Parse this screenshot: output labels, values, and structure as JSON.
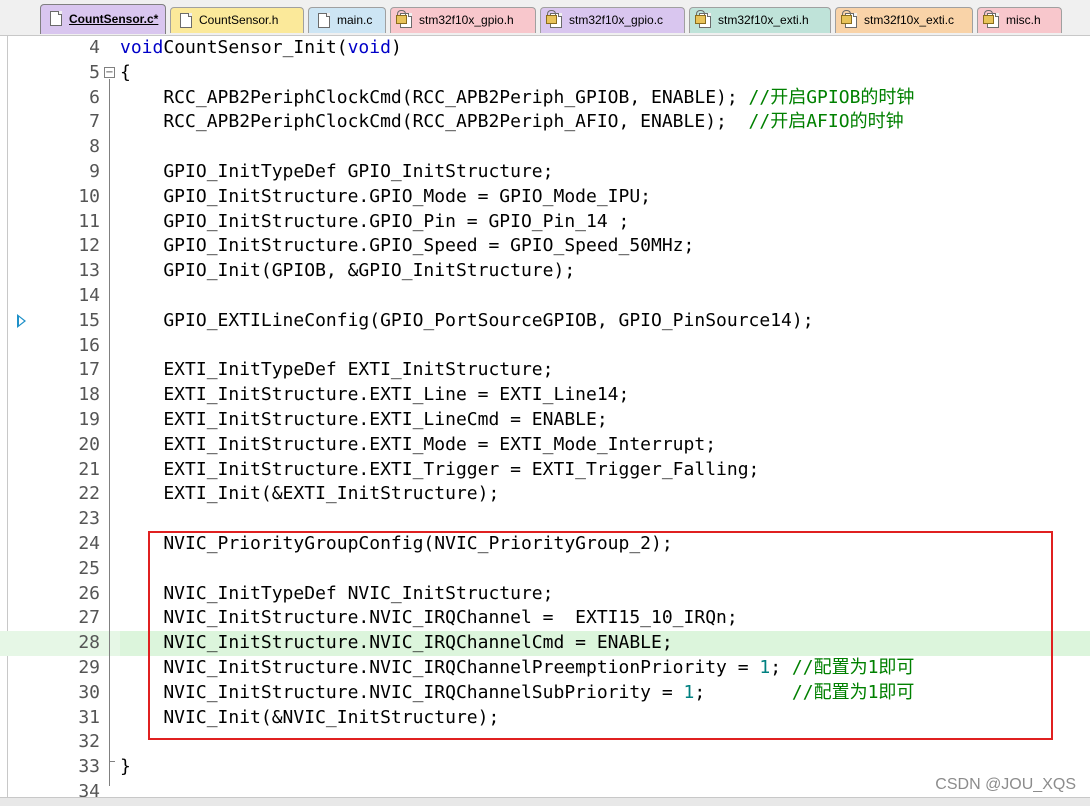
{
  "tabs": [
    {
      "label": "CountSensor.c*",
      "active": true,
      "locked": false,
      "color": "#d9c6ef"
    },
    {
      "label": "CountSensor.h",
      "active": false,
      "locked": false,
      "color": "#fbe99a"
    },
    {
      "label": "main.c",
      "active": false,
      "locked": false,
      "color": "#cde5f4"
    },
    {
      "label": "stm32f10x_gpio.h",
      "active": false,
      "locked": true,
      "color": "#f8c7cc"
    },
    {
      "label": "stm32f10x_gpio.c",
      "active": false,
      "locked": true,
      "color": "#d9c6ef"
    },
    {
      "label": "stm32f10x_exti.h",
      "active": false,
      "locked": true,
      "color": "#bfe3d9"
    },
    {
      "label": "stm32f10x_exti.c",
      "active": false,
      "locked": true,
      "color": "#f9d3a8"
    },
    {
      "label": "misc.h",
      "active": false,
      "locked": true,
      "color": "#f8c7cc"
    }
  ],
  "editor": {
    "current_line": 28,
    "breakpoint_line": 15,
    "lines": [
      {
        "n": "4",
        "code": [
          [
            "kw",
            "void"
          ],
          [
            "",
            "CountSensor_Init("
          ],
          [
            "kw",
            "void"
          ],
          [
            "",
            ")"
          ]
        ]
      },
      {
        "n": "5",
        "code": [
          [
            "",
            "{"
          ]
        ]
      },
      {
        "n": "6",
        "code": [
          [
            "",
            "    RCC_APB2PeriphClockCmd(RCC_APB2Periph_GPIOB, ENABLE); "
          ],
          [
            "cmt",
            "//开启GPIOB的时钟"
          ]
        ]
      },
      {
        "n": "7",
        "code": [
          [
            "",
            "    RCC_APB2PeriphClockCmd(RCC_APB2Periph_AFIO, ENABLE);  "
          ],
          [
            "cmt",
            "//开启AFIO的时钟"
          ]
        ]
      },
      {
        "n": "8",
        "code": []
      },
      {
        "n": "9",
        "code": [
          [
            "",
            "    GPIO_InitTypeDef GPIO_InitStructure;"
          ]
        ]
      },
      {
        "n": "10",
        "code": [
          [
            "",
            "    GPIO_InitStructure.GPIO_Mode = GPIO_Mode_IPU;"
          ]
        ]
      },
      {
        "n": "11",
        "code": [
          [
            "",
            "    GPIO_InitStructure.GPIO_Pin = GPIO_Pin_14 ;"
          ]
        ]
      },
      {
        "n": "12",
        "code": [
          [
            "",
            "    GPIO_InitStructure.GPIO_Speed = GPIO_Speed_50MHz;"
          ]
        ]
      },
      {
        "n": "13",
        "code": [
          [
            "",
            "    GPIO_Init(GPIOB, &GPIO_InitStructure);"
          ]
        ]
      },
      {
        "n": "14",
        "code": []
      },
      {
        "n": "15",
        "code": [
          [
            "",
            "    GPIO_EXTILineConfig(GPIO_PortSourceGPIOB, GPIO_PinSource14);"
          ]
        ]
      },
      {
        "n": "16",
        "code": []
      },
      {
        "n": "17",
        "code": [
          [
            "",
            "    EXTI_InitTypeDef EXTI_InitStructure;"
          ]
        ]
      },
      {
        "n": "18",
        "code": [
          [
            "",
            "    EXTI_InitStructure.EXTI_Line = EXTI_Line14;"
          ]
        ]
      },
      {
        "n": "19",
        "code": [
          [
            "",
            "    EXTI_InitStructure.EXTI_LineCmd = ENABLE;"
          ]
        ]
      },
      {
        "n": "20",
        "code": [
          [
            "",
            "    EXTI_InitStructure.EXTI_Mode = EXTI_Mode_Interrupt;"
          ]
        ]
      },
      {
        "n": "21",
        "code": [
          [
            "",
            "    EXTI_InitStructure.EXTI_Trigger = EXTI_Trigger_Falling;"
          ]
        ]
      },
      {
        "n": "22",
        "code": [
          [
            "",
            "    EXTI_Init(&EXTI_InitStructure);"
          ]
        ]
      },
      {
        "n": "23",
        "code": []
      },
      {
        "n": "24",
        "code": [
          [
            "",
            "    NVIC_PriorityGroupConfig(NVIC_PriorityGroup_2);"
          ]
        ]
      },
      {
        "n": "25",
        "code": []
      },
      {
        "n": "26",
        "code": [
          [
            "",
            "    NVIC_InitTypeDef NVIC_InitStructure;"
          ]
        ]
      },
      {
        "n": "27",
        "code": [
          [
            "",
            "    NVIC_InitStructure.NVIC_IRQChannel =  EXTI15_10_IRQn;"
          ]
        ]
      },
      {
        "n": "28",
        "code": [
          [
            "",
            "    NVIC_InitStructure.NVIC_IRQChannelCmd = ENABLE;"
          ]
        ]
      },
      {
        "n": "29",
        "code": [
          [
            "",
            "    NVIC_InitStructure.NVIC_IRQChannelPreemptionPriority = "
          ],
          [
            "num",
            "1"
          ],
          [
            "",
            "; "
          ],
          [
            "cmt",
            "//配置为1即可"
          ]
        ]
      },
      {
        "n": "30",
        "code": [
          [
            "",
            "    NVIC_InitStructure.NVIC_IRQChannelSubPriority = "
          ],
          [
            "num",
            "1"
          ],
          [
            "",
            ";        "
          ],
          [
            "cmt",
            "//配置为1即可"
          ]
        ]
      },
      {
        "n": "31",
        "code": [
          [
            "",
            "    NVIC_Init(&NVIC_InitStructure);"
          ]
        ]
      },
      {
        "n": "32",
        "code": []
      },
      {
        "n": "33",
        "code": [
          [
            "",
            "}"
          ]
        ]
      },
      {
        "n": "34",
        "code": []
      }
    ]
  },
  "watermark": "CSDN @JOU_XQS"
}
